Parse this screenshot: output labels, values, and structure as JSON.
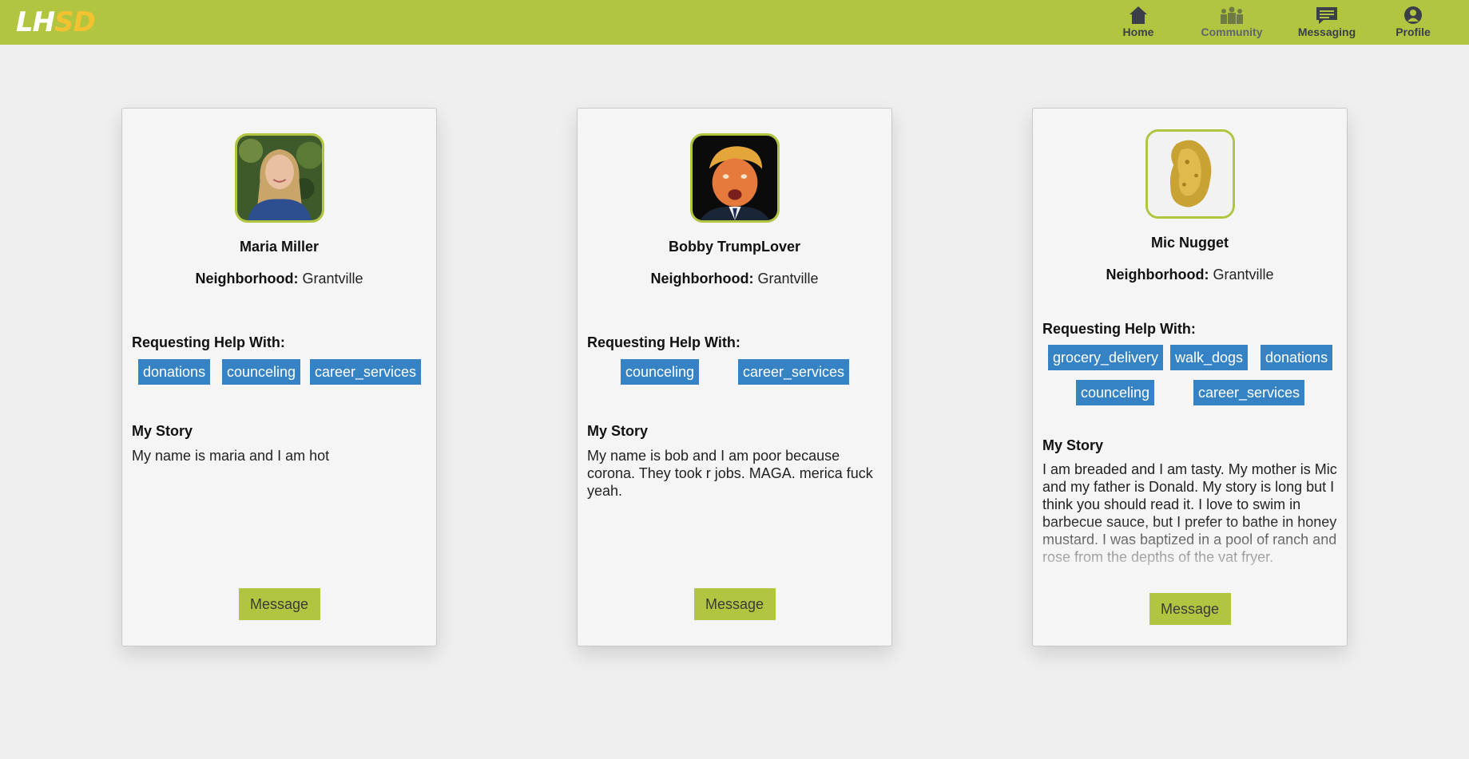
{
  "brand": {
    "logo_part1": "LH",
    "logo_part2": "SD"
  },
  "nav": {
    "items": [
      {
        "label": "Home",
        "icon": "home-icon"
      },
      {
        "label": "Community",
        "icon": "community-icon"
      },
      {
        "label": "Messaging",
        "icon": "messaging-icon"
      },
      {
        "label": "Profile",
        "icon": "profile-icon"
      }
    ]
  },
  "colors": {
    "navbar": "#b2c540",
    "tag_bg": "#3582c4",
    "button_bg": "#b2c540",
    "avatar_border": "#b2c540",
    "logo_accent": "#f2c230"
  },
  "cards": [
    {
      "name": "Maria Miller",
      "neighborhood_label": "Neighborhood:",
      "neighborhood": "Grantville",
      "requesting_label": "Requesting Help With:",
      "tags": [
        "donations",
        "counceling",
        "career_services"
      ],
      "story_label": "My Story",
      "story": "My name is maria and I am hot",
      "button": "Message",
      "avatar": "woman-portrait-photo"
    },
    {
      "name": "Bobby TrumpLover",
      "neighborhood_label": "Neighborhood:",
      "neighborhood": "Grantville",
      "requesting_label": "Requesting Help With:",
      "tags": [
        "counceling",
        "career_services"
      ],
      "story_label": "My Story",
      "story": "My name is bob and I am poor because corona. They took r jobs. MAGA. merica fuck yeah.",
      "button": "Message",
      "avatar": "caricature-portrait-photo"
    },
    {
      "name": "Mic Nugget",
      "neighborhood_label": "Neighborhood:",
      "neighborhood": "Grantville",
      "requesting_label": "Requesting Help With:",
      "tags": [
        "grocery_delivery",
        "walk_dogs",
        "donations",
        "counceling",
        "career_services"
      ],
      "story_label": "My Story",
      "story": "I am breaded and I am tasty. My mother is Mic and my father is Donald. My story is long but I think you should read it. I love to swim in barbecue sauce, but I prefer to bathe in honey mustard. I was baptized in a pool of ranch and rose from the depths of the vat fryer.",
      "button": "Message",
      "avatar": "chicken-nugget-photo"
    }
  ]
}
